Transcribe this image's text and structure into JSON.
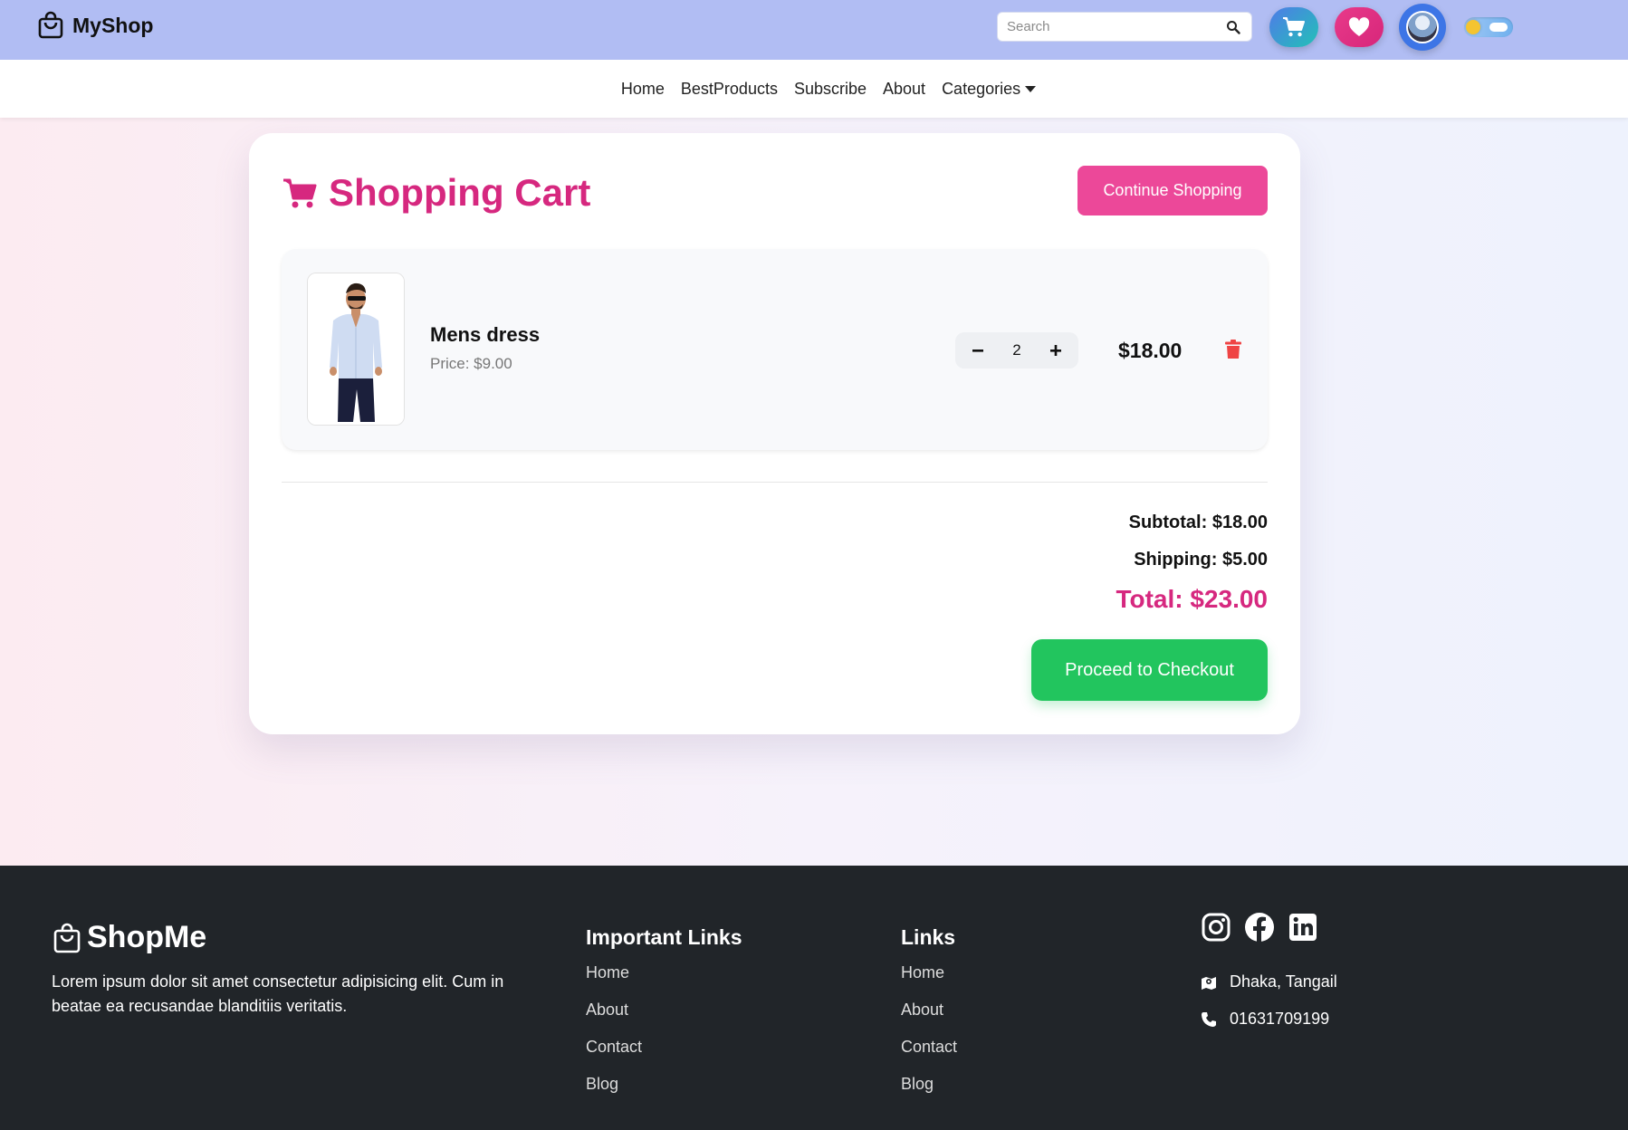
{
  "header": {
    "brand": "MyShop",
    "search_placeholder": "Search",
    "icons": {
      "brand": "shopping-bag-icon",
      "search": "search-icon",
      "cart": "cart-icon",
      "wishlist": "heart-icon",
      "avatar": "user-avatar",
      "theme": "theme-toggle"
    }
  },
  "nav": {
    "items": [
      "Home",
      "BestProducts",
      "Subscribe",
      "About",
      "Categories"
    ]
  },
  "cart": {
    "title": "Shopping Cart",
    "continue_label": "Continue Shopping",
    "items": [
      {
        "name": "Mens dress",
        "price_label": "Price: $9.00",
        "quantity": "2",
        "line_total": "$18.00"
      }
    ],
    "subtotal_label": "Subtotal: $18.00",
    "shipping_label": "Shipping: $5.00",
    "total_label": "Total: $23.00",
    "checkout_label": "Proceed to Checkout"
  },
  "footer": {
    "brand": "ShopMe",
    "description": "Lorem ipsum dolor sit amet consectetur adipisicing elit. Cum in beatae ea recusandae blanditiis veritatis.",
    "important_links": {
      "title": "Important Links",
      "items": [
        "Home",
        "About",
        "Contact",
        "Blog"
      ]
    },
    "links": {
      "title": "Links",
      "items": [
        "Home",
        "About",
        "Contact",
        "Blog"
      ]
    },
    "socials": [
      "instagram-icon",
      "facebook-icon",
      "linkedin-icon"
    ],
    "location": "Dhaka, Tangail",
    "phone": "01631709199"
  },
  "colors": {
    "header_bg": "#b1bdf3",
    "accent_pink": "#d6287f",
    "button_pink": "#ec4899",
    "checkout_green": "#22c55e",
    "delete_red": "#ef4444",
    "footer_bg": "#212529"
  }
}
